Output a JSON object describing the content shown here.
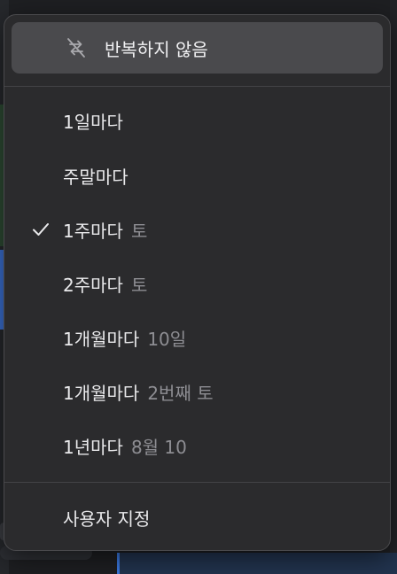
{
  "menu": {
    "no_repeat": {
      "label": "반복하지 않음",
      "icon": "repeat-off-icon"
    },
    "items": [
      {
        "label": "1일마다",
        "detail": "",
        "checked": false
      },
      {
        "label": "주말마다",
        "detail": "",
        "checked": false
      },
      {
        "label": "1주마다",
        "detail": "토",
        "checked": true
      },
      {
        "label": "2주마다",
        "detail": "토",
        "checked": false
      },
      {
        "label": "1개월마다",
        "detail": "10일",
        "checked": false
      },
      {
        "label": "1개월마다",
        "detail": "2번째 토",
        "checked": false
      },
      {
        "label": "1년마다",
        "detail": "8월 10",
        "checked": false
      }
    ],
    "custom": {
      "label": "사용자 지정"
    }
  },
  "colors": {
    "menu_bg": "#2b2b2d",
    "highlight": "#4a4a4d",
    "text": "#e9e9eb",
    "detail_text": "#8d8d92"
  }
}
